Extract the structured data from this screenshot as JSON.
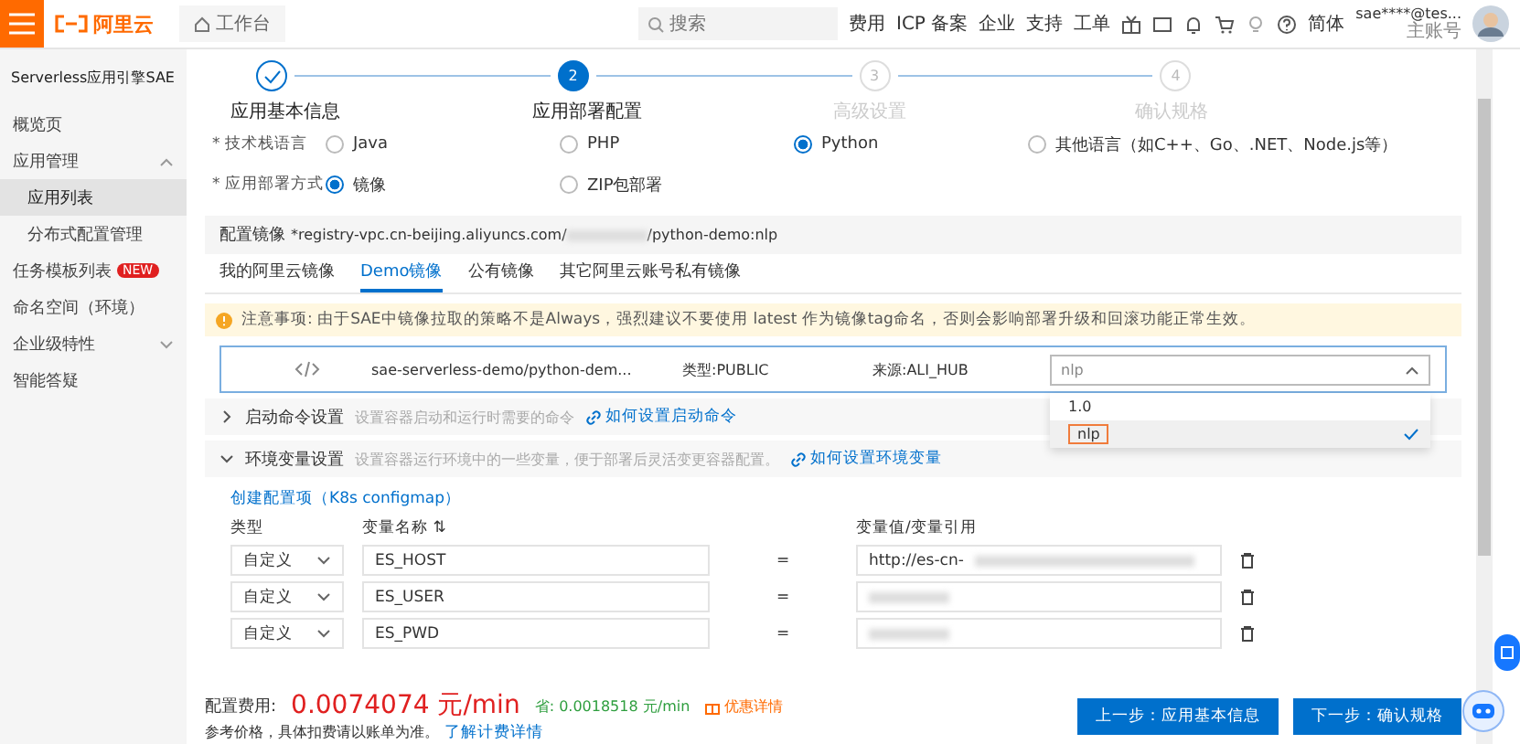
{
  "topbar": {
    "logo": "阿里云",
    "home": "工作台",
    "search": {
      "placeholder": "搜索"
    },
    "nav": [
      "费用",
      "ICP 备案",
      "企业",
      "支持",
      "工单"
    ],
    "language": "简体",
    "user": {
      "name": "sae****@tes...",
      "role": "主账号"
    }
  },
  "sidebar": {
    "title": "Serverless应用引擎SAE",
    "items": [
      {
        "label": "概览页",
        "selected": false
      },
      {
        "label": "应用管理",
        "expanded": true,
        "children": [
          {
            "label": "应用列表",
            "selected": true
          },
          {
            "label": "分布式配置管理",
            "selected": false
          }
        ]
      },
      {
        "label": "任务模板列表",
        "badge": "NEW",
        "selected": false
      },
      {
        "label": "命名空间（环境）",
        "selected": false
      },
      {
        "label": "企业级特性",
        "expanded": false
      },
      {
        "label": "智能答疑",
        "selected": false
      }
    ]
  },
  "steps": [
    {
      "label": "应用基本信息",
      "completed": true,
      "selected": false
    },
    {
      "label": "应用部署配置",
      "number": "2",
      "completed": false,
      "selected": true
    },
    {
      "label": "高级设置",
      "number": "3",
      "completed": false,
      "selected": false
    },
    {
      "label": "确认规格",
      "number": "4",
      "completed": false,
      "selected": false
    }
  ],
  "form": [
    {
      "label": "* 技术栈语言",
      "options": [
        {
          "label": "Java",
          "selected": false
        },
        {
          "label": "PHP",
          "selected": false
        },
        {
          "label": "Python",
          "selected": true
        },
        {
          "label": "其他语言（如C++、Go、.NET、Node.js等）",
          "selected": false
        }
      ]
    },
    {
      "label": "* 应用部署方式",
      "options": [
        {
          "label": "镜像",
          "selected": true
        },
        {
          "label": "ZIP包部署",
          "selected": false
        }
      ]
    }
  ],
  "image_config": {
    "label": "配置镜像",
    "value_start": "*registry-vpc.cn-beijing.aliyuncs.com/",
    "value_end": "/python-demo:nlp",
    "tabs": [
      {
        "label": "我的阿里云镜像",
        "selected": false
      },
      {
        "label": "Demo镜像",
        "selected": true
      },
      {
        "label": "公有镜像",
        "selected": false
      },
      {
        "label": "其它阿里云账号私有镜像",
        "selected": false
      }
    ],
    "notice": "注意事项: 由于SAE中镜像拉取的策略不是Always，强烈建议不要使用 latest 作为镜像tag命名，否则会影响部署升级和回滚功能正常生效。",
    "image": {
      "name": "sae-serverless-demo/python-dem...",
      "type": "类型:PUBLIC",
      "source": "来源:ALI_HUB",
      "tag": "nlp",
      "options": [
        {
          "label": "1.0",
          "selected": false
        },
        {
          "label": "nlp",
          "selected": true
        }
      ]
    }
  },
  "sections": [
    {
      "title": "启动命令设置",
      "hint": "设置容器启动和运行时需要的命令",
      "link": "如何设置启动命令",
      "expanded": false
    },
    {
      "title": "环境变量设置",
      "hint": "设置容器运行环境中的一些变量，便于部署后灵活变更容器配置。",
      "link": "如何设置环境变量",
      "expanded": true
    }
  ],
  "env": {
    "create_link": "创建配置项（K8s configmap）",
    "columns": [
      "类型",
      "变量名称 ⇅",
      "变量值/变量引用"
    ],
    "equals": "=",
    "rows": [
      {
        "type": "自定义",
        "name": "ES_HOST",
        "value": "http://es-cn-"
      },
      {
        "type": "自定义",
        "name": "ES_USER"
      },
      {
        "type": "自定义",
        "name": "ES_PWD"
      }
    ]
  },
  "footer": {
    "cost_label": "配置费用:",
    "cost": "0.0074074 元/min",
    "save": "省: 0.0018518 元/min",
    "discount": "优惠详情",
    "note": "参考价格，具体扣费请以账单为准。",
    "note_link": "了解计费详情",
    "buttons": [
      "上一步：应用基本信息",
      "下一步：确认规格"
    ]
  }
}
